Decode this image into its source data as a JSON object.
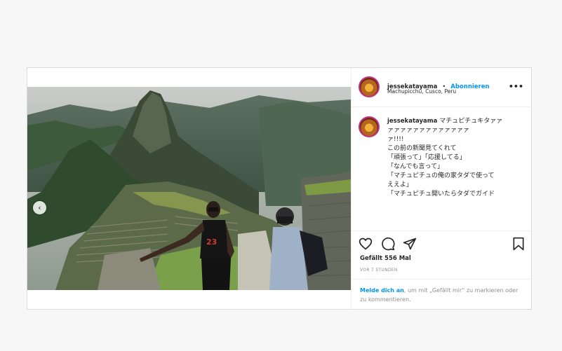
{
  "post": {
    "username": "jessekatayama",
    "separator": "•",
    "follow_label": "Abonnieren",
    "location": "Machupicchu, Cusco, Peru",
    "more_icon": "more-horizontal-icon",
    "carousel_prev_icon": "chevron-left-icon"
  },
  "caption": {
    "username": "jessekatayama",
    "lines": [
      "マチュピチュキタァァ",
      "ァァァァァァァァァァァァァ",
      "ァ!!!!",
      "",
      "この前の新聞見てくれて",
      "",
      "「頑張って」「応援してる」",
      "「なんでも言って」",
      "「マチュピチュの俺の家タダで使って",
      "ええよ」",
      "「マチュピチュ開いたらタダでガイド"
    ]
  },
  "actions": {
    "icons": [
      "heart-icon",
      "comment-icon",
      "share-icon",
      "bookmark-icon"
    ],
    "likes": "Gefällt 556 Mal",
    "time": "VOR 7 STUNDEN"
  },
  "login": {
    "link": "Melde dich an",
    "text": ", um mit „Gefällt mir“ zu markieren oder zu kommentieren."
  }
}
